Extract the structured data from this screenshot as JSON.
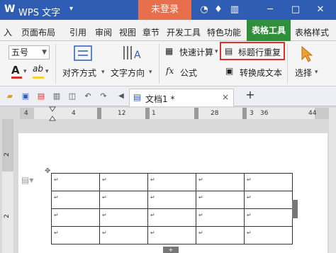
{
  "titlebar": {
    "logo": "W",
    "app_title": "WPS 文字",
    "dropdown_arrow": "▾",
    "login_label": "未登录",
    "icons": [
      "shirt-icon",
      "tshirt-icon",
      "menu-icon",
      "minimize-icon",
      "maximize-icon",
      "close-icon"
    ]
  },
  "menubar": {
    "tabs": [
      "入",
      "页面布局",
      "引用",
      "审阅",
      "视图",
      "章节",
      "开发工具",
      "特色功能"
    ],
    "active_tab": "表格工具",
    "extra_tab": "表格样式"
  },
  "ribbon": {
    "font_size": "五号",
    "font_color_label": "A",
    "highlight_label": "ab",
    "align_label": "对齐方式",
    "text_dir_label": "文字方向",
    "quick_calc_label": "快速计算",
    "header_repeat_label": "标题行重复",
    "formula_label": "公式",
    "convert_label": "转换成文本",
    "select_label": "选择",
    "colors": {
      "underline_red": "#d9322b",
      "underline_yellow": "#f5d32a",
      "highlight_border": "#d9322b"
    }
  },
  "quick_access": {
    "icons": [
      "folder-icon",
      "save-icon",
      "pdf-icon",
      "print-icon",
      "preview-icon",
      "undo-icon",
      "redo-icon"
    ],
    "doc_tab": {
      "name": "文档1 *",
      "close": "×"
    },
    "new_tab": "+",
    "nav_left": "◀"
  },
  "ruler": {
    "numbers": [
      "4",
      "4",
      "12",
      "1",
      "28",
      "3",
      "36",
      "44"
    ],
    "vertical_numbers": [
      "2",
      "2"
    ]
  },
  "table": {
    "rows": 4,
    "cols": 5,
    "cell_mark": "↵"
  }
}
